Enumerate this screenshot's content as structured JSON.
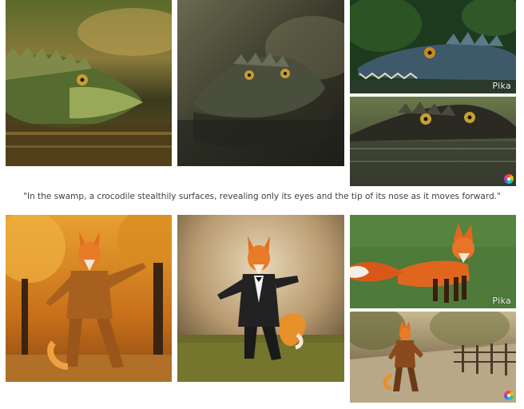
{
  "caption": "\"In the swamp, a crocodile stealthily surfaces, revealing only its eyes and the tip of its nose as it moves forward.\"",
  "watermarks": {
    "pika_text": "Pika"
  },
  "images": [
    {
      "name": "crocodile-left",
      "subject": "crocodile in swamp water, golden light"
    },
    {
      "name": "crocodile-center",
      "subject": "crocodile head surfacing, dark reflective water"
    },
    {
      "name": "crocodile-top-right",
      "subject": "crocodile profile with green background"
    },
    {
      "name": "crocodile-bottom-right",
      "subject": "crocodile eyes above water"
    },
    {
      "name": "fox-left",
      "subject": "fox in brown suit dancing among autumn trees"
    },
    {
      "name": "fox-center",
      "subject": "fox in tuxedo dancing on grass"
    },
    {
      "name": "fox-top-right",
      "subject": "fox walking on green grass"
    },
    {
      "name": "fox-bottom-right",
      "subject": "fox in suit walking on path by fence"
    }
  ],
  "colors": {
    "caption_text": "#404040",
    "background": "#ffffff"
  }
}
